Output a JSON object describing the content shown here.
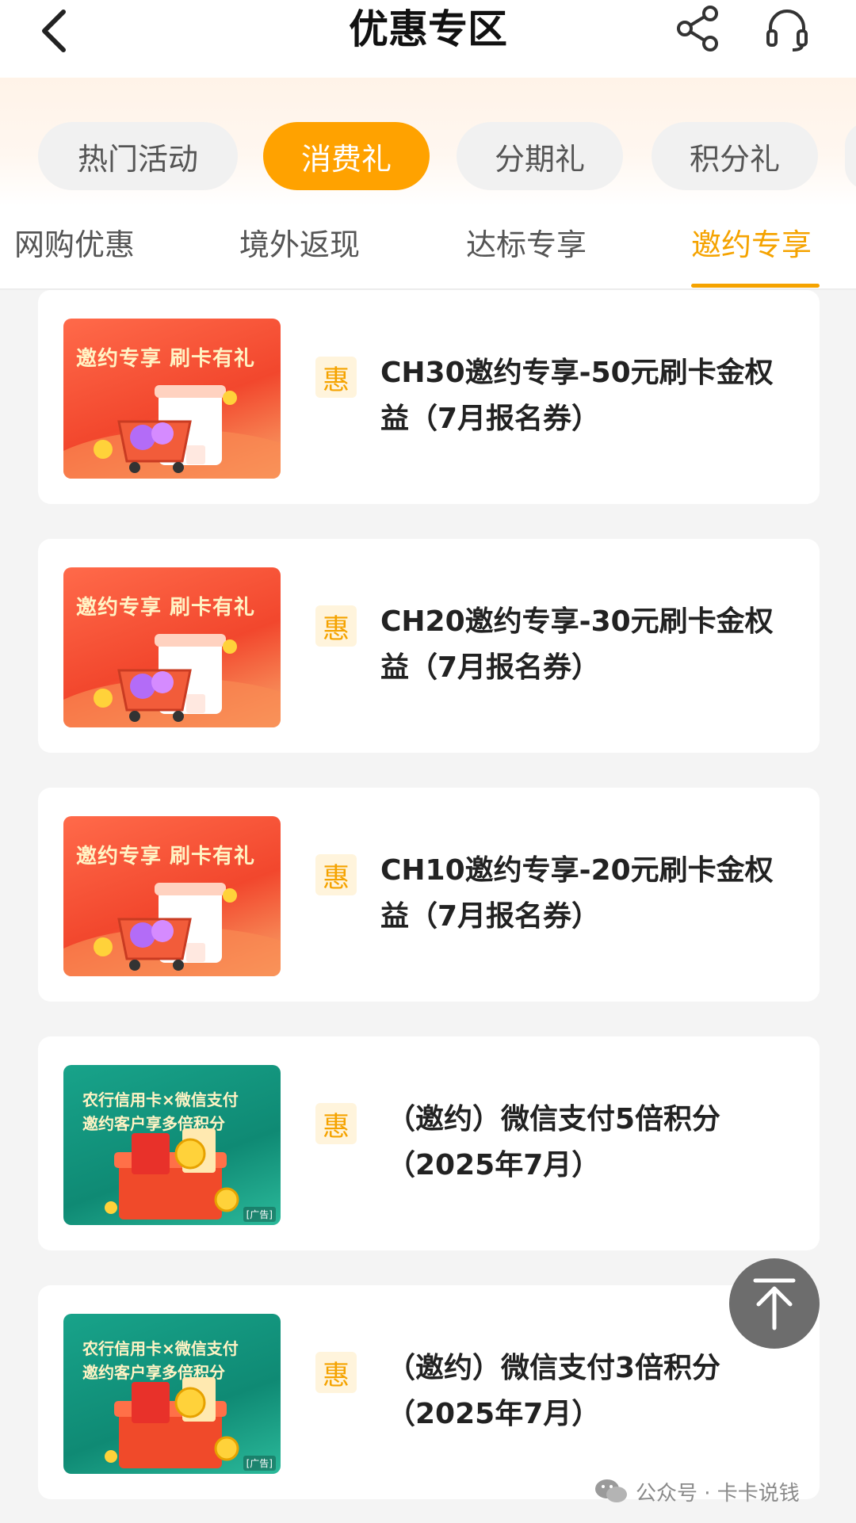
{
  "header": {
    "title": "优惠专区",
    "back_icon": "chevron-left-icon",
    "share_icon": "share-icon",
    "service_icon": "headset-icon"
  },
  "categories": [
    {
      "label": "热门活动",
      "active": false
    },
    {
      "label": "消费礼",
      "active": true
    },
    {
      "label": "分期礼",
      "active": false
    },
    {
      "label": "积分礼",
      "active": false
    }
  ],
  "sub_tabs": [
    {
      "label": "网购优惠",
      "active": false
    },
    {
      "label": "境外返现",
      "active": false
    },
    {
      "label": "达标专享",
      "active": false
    },
    {
      "label": "邀约专享",
      "active": true
    }
  ],
  "badge_text": "惠",
  "thumbs": {
    "red_headline": "邀约专享 刷卡有礼",
    "green_headline1": "农行信用卡×微信支付",
    "green_headline2": "邀约客户享多倍积分",
    "green_tag": "[广告]"
  },
  "offers": [
    {
      "title": "CH30邀约专享-50元刷卡金权益（7月报名券）",
      "theme": "red"
    },
    {
      "title": "CH20邀约专享-30元刷卡金权益（7月报名券）",
      "theme": "red"
    },
    {
      "title": "CH10邀约专享-20元刷卡金权益（7月报名券）",
      "theme": "red"
    },
    {
      "title": "（邀约）微信支付5倍积分（2025年7月）",
      "theme": "green"
    },
    {
      "title": "（邀约）微信支付3倍积分（2025年7月）",
      "theme": "green"
    }
  ],
  "watermark": "公众号 · 卡卡说钱",
  "colors": {
    "accent": "#ffa200",
    "tab_active": "#f5a300"
  }
}
